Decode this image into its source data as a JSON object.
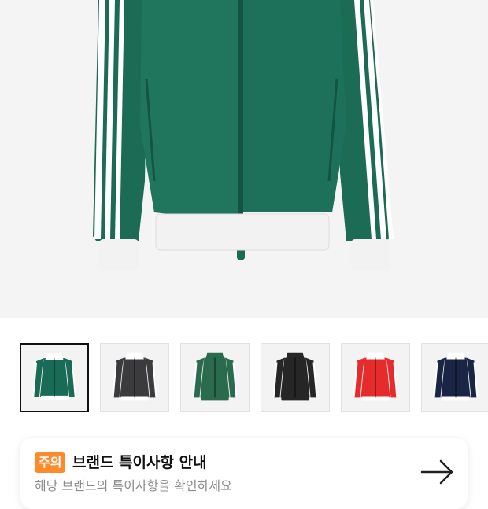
{
  "product": {
    "main_image_icon": "green-track-jacket-image"
  },
  "gallery": {
    "thumbnails": [
      {
        "color": "#1a6b55",
        "stripe": "#ffffff",
        "trim": "#ffffff",
        "selected": true
      },
      {
        "color": "#3b3b3e",
        "stripe": "#ffffff",
        "trim": "#ffffff",
        "selected": false
      },
      {
        "color": "#2a6b4e",
        "stripe": "#ffffff",
        "trim": "#2a6b4e",
        "selected": false
      },
      {
        "color": "#262626",
        "stripe": "#ffffff",
        "trim": "#262626",
        "selected": false
      },
      {
        "color": "#e52b2b",
        "stripe": "#ffffff",
        "trim": "#ffffff",
        "selected": false
      },
      {
        "color": "#1a2445",
        "stripe": "#ffffff",
        "trim": "#ffffff",
        "selected": false
      }
    ]
  },
  "notice": {
    "badge": "주의",
    "title": "브랜드 특이사항 안내",
    "subtitle": "해당 브랜드의 특이사항을 확인하세요",
    "arrow_icon": "arrow-right-icon",
    "badge_color": "#ff8a2a"
  }
}
